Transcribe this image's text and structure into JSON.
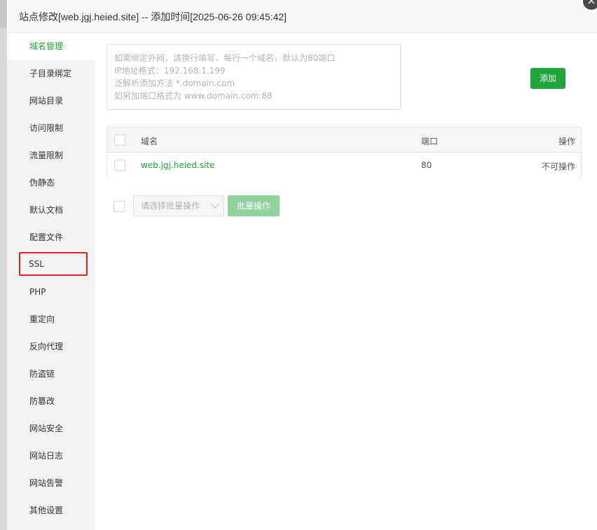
{
  "dialog": {
    "title": "站点修改[web.jgj.heied.site] -- 添加时间[2025-06-26 09:45:42]",
    "close_glyph": "×"
  },
  "sidebar": {
    "active_color": "#20a53a",
    "items": [
      {
        "label": "域名管理",
        "state": "active"
      },
      {
        "label": "子目录绑定"
      },
      {
        "label": "网站目录"
      },
      {
        "label": "访问限制"
      },
      {
        "label": "流量限制"
      },
      {
        "label": "伪静态"
      },
      {
        "label": "默认文档"
      },
      {
        "label": "配置文件"
      },
      {
        "label": "SSL",
        "state": "highlighted"
      },
      {
        "label": "PHP"
      },
      {
        "label": "重定向"
      },
      {
        "label": "反向代理"
      },
      {
        "label": "防盗链"
      },
      {
        "label": "防篡改"
      },
      {
        "label": "网站安全"
      },
      {
        "label": "网站日志"
      },
      {
        "label": "网站告警"
      },
      {
        "label": "其他设置"
      }
    ]
  },
  "domain_form": {
    "placeholder_lines": [
      "如需绑定外网，请换行填写，每行一个域名，默认为80端口",
      "IP地址格式：192.168.1.199",
      "泛解析添加方法 *.domain.com",
      "如另加端口格式为 www.domain.com:88"
    ],
    "add_button": "添加",
    "button_color": "#20a53a"
  },
  "table": {
    "columns": [
      "域名",
      "端口",
      "操作"
    ],
    "rows": [
      {
        "domain": "web.jgj.heied.site",
        "port": "80",
        "action": "不可操作"
      }
    ]
  },
  "batch": {
    "select_placeholder": "请选择批量操作",
    "button_label": "批量操作"
  }
}
